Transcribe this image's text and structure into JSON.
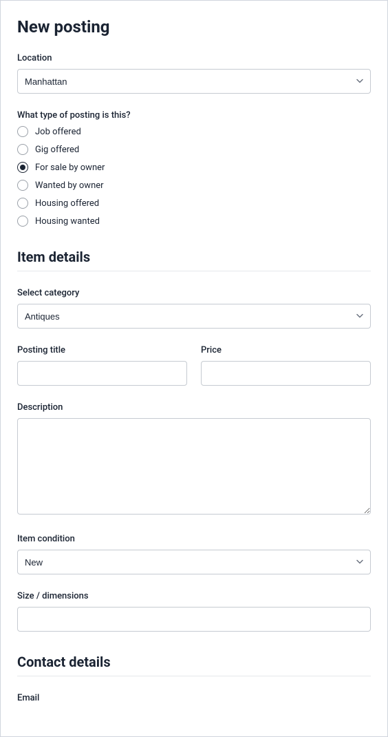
{
  "page_title": "New posting",
  "location": {
    "label": "Location",
    "value": "Manhattan"
  },
  "posting_type": {
    "label": "What type of posting is this?",
    "options": [
      {
        "label": "Job offered",
        "selected": false
      },
      {
        "label": "Gig offered",
        "selected": false
      },
      {
        "label": "For sale by owner",
        "selected": true
      },
      {
        "label": "Wanted by owner",
        "selected": false
      },
      {
        "label": "Housing offered",
        "selected": false
      },
      {
        "label": "Housing wanted",
        "selected": false
      }
    ]
  },
  "item_details": {
    "title": "Item details",
    "category": {
      "label": "Select category",
      "value": "Antiques"
    },
    "posting_title": {
      "label": "Posting title",
      "value": ""
    },
    "price": {
      "label": "Price",
      "value": ""
    },
    "description": {
      "label": "Description",
      "value": ""
    },
    "condition": {
      "label": "Item condition",
      "value": "New"
    },
    "size": {
      "label": "Size / dimensions",
      "value": ""
    }
  },
  "contact_details": {
    "title": "Contact details",
    "email": {
      "label": "Email",
      "value": ""
    }
  }
}
